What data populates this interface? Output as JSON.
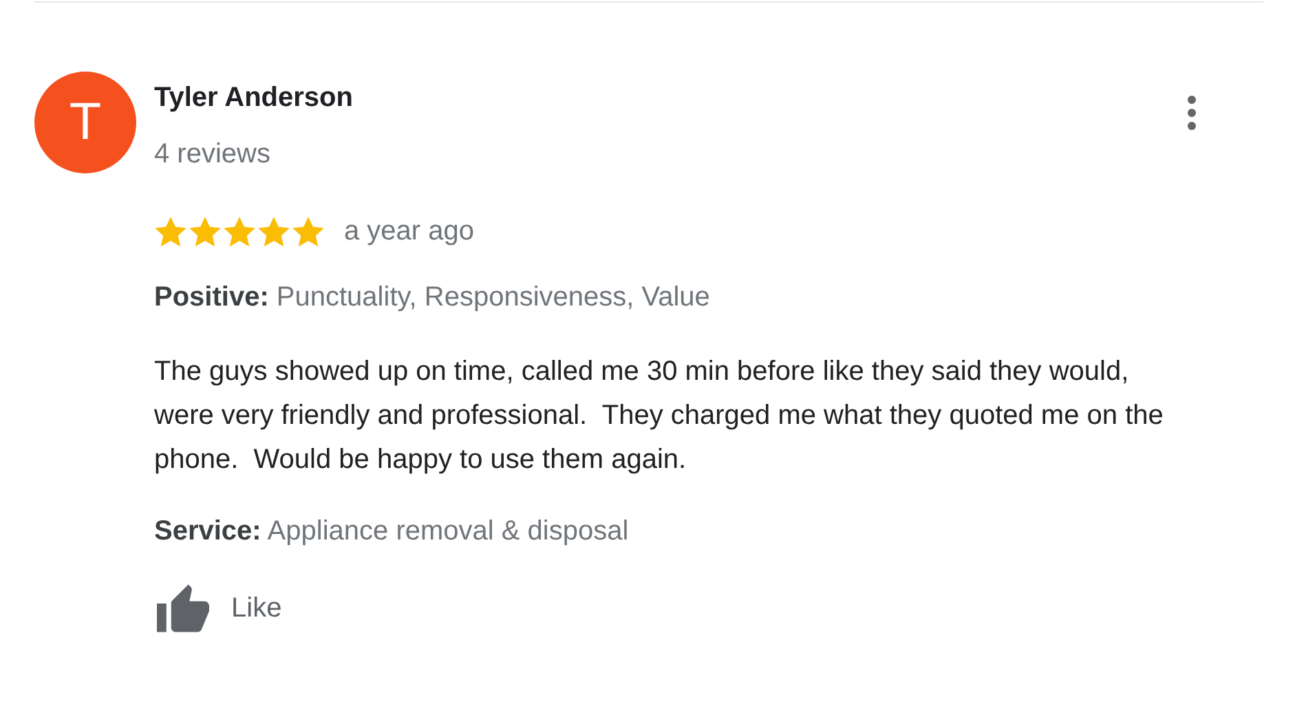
{
  "review": {
    "avatar_letter": "T",
    "reviewer": "Tyler Anderson",
    "reviews_count": "4 reviews",
    "stars": 5,
    "time": "a year ago",
    "positive": "**Positive:** Punctuality, Responsiveness, Value",
    "text": "The guys showed up on time, called me 30 min before like they said they would, were very friendly and professional.  They charged me what they quoted me on the phone.  Would be happy to use them again.",
    "service": "**Service:** Appliance removal & disposal",
    "like": "Like"
  }
}
